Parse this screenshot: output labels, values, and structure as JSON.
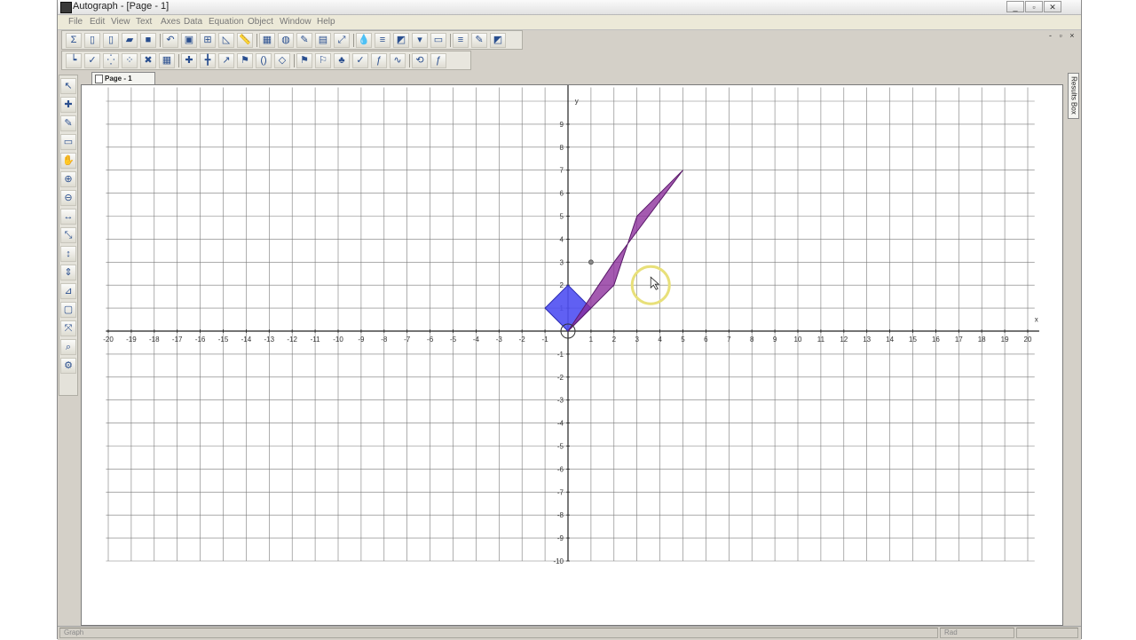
{
  "window": {
    "title": "Autograph - [Page - 1]",
    "controls": [
      "_",
      "▫",
      "✕"
    ],
    "inner_controls": "- ▫ ×"
  },
  "menu": [
    "File",
    "Edit",
    "View",
    "Text",
    "Axes",
    "Data",
    "Equation",
    "Object",
    "Window",
    "Help"
  ],
  "toolbar1_icons": [
    "sigma-icon",
    "new-page-icon",
    "new-2d-page-icon",
    "open-folder-icon",
    "save-disk-icon",
    "undo-icon",
    "select-all-icon",
    "edit-axes-icon",
    "graph-tool-icon",
    "ruler-icon",
    "grid-icon",
    "globe-icon",
    "edit-object-icon",
    "text-box-icon",
    "zoom-fit-icon",
    "drop-icon",
    "line-style-icon",
    "fill-icon",
    "arrow-down-icon",
    "monitor-icon",
    "list-icon",
    "pencil-color-icon",
    "paint-bucket-icon"
  ],
  "toolbar2_icons": [
    "axes-icon",
    "tick-icon",
    "point-mode-icon",
    "scatter-icon",
    "delete-icon",
    "table-icon",
    "add-point-icon",
    "add-line-icon",
    "add-vector-icon",
    "flag-icon",
    "bracket-icon",
    "shape-icon",
    "flag-group-icon",
    "flag-alt-icon",
    "leaf-icon",
    "check-icon",
    "fx-icon",
    "curve-icon",
    "transform-icon",
    "fg-icon"
  ],
  "left_tools": [
    "select-arrow-icon",
    "point-add-icon",
    "pencil-icon",
    "eraser-icon",
    "hand-pan-icon",
    "zoom-in-icon",
    "zoom-out-icon",
    "scale-x-icon",
    "scale-xy-icon",
    "scale-y-icon",
    "scale-dy-icon",
    "measure-icon",
    "box-icon",
    "scale-tool-icon",
    "magnifier-icon",
    "tool-extra-icon"
  ],
  "tab": {
    "label": "Page - 1"
  },
  "results_box": {
    "label": "Results Box"
  },
  "graph": {
    "xlim": [
      -20,
      20
    ],
    "ylim": [
      -10,
      10
    ],
    "x_axis_label": "x",
    "y_axis_label": "y",
    "x_tick_labels": [
      "-20",
      "-19",
      "-18",
      "-17",
      "-16",
      "-15",
      "-14",
      "-13",
      "-12",
      "-11",
      "-10",
      "-9",
      "-8",
      "-7",
      "-6",
      "-5",
      "-4",
      "-3",
      "-2",
      "-1",
      "1",
      "2",
      "3",
      "4",
      "5",
      "6",
      "7",
      "8",
      "9",
      "10",
      "11",
      "12",
      "13",
      "14",
      "15",
      "16",
      "17",
      "18",
      "19",
      "20"
    ],
    "y_tick_labels": [
      "9",
      "8",
      "7",
      "6",
      "5",
      "4",
      "3",
      "2",
      "1",
      "-1",
      "-2",
      "-3",
      "-4",
      "-5",
      "-6",
      "-7",
      "-8",
      "-9",
      "-10"
    ],
    "blue_square": [
      [
        0,
        0
      ],
      [
        1,
        1
      ],
      [
        0,
        2
      ],
      [
        -1,
        1
      ]
    ],
    "purple_shape": [
      [
        0,
        0
      ],
      [
        1,
        1
      ],
      [
        2,
        2
      ],
      [
        3,
        5
      ],
      [
        5,
        7
      ],
      [
        2,
        3
      ]
    ],
    "colors": {
      "blue": "#4f4ff2",
      "purple": "#8a2c9a",
      "highlight": "#e8e07a",
      "grid": "#7a7a7a"
    }
  },
  "status": {
    "left": "Graph",
    "right1": "Rad",
    "right2": ""
  }
}
